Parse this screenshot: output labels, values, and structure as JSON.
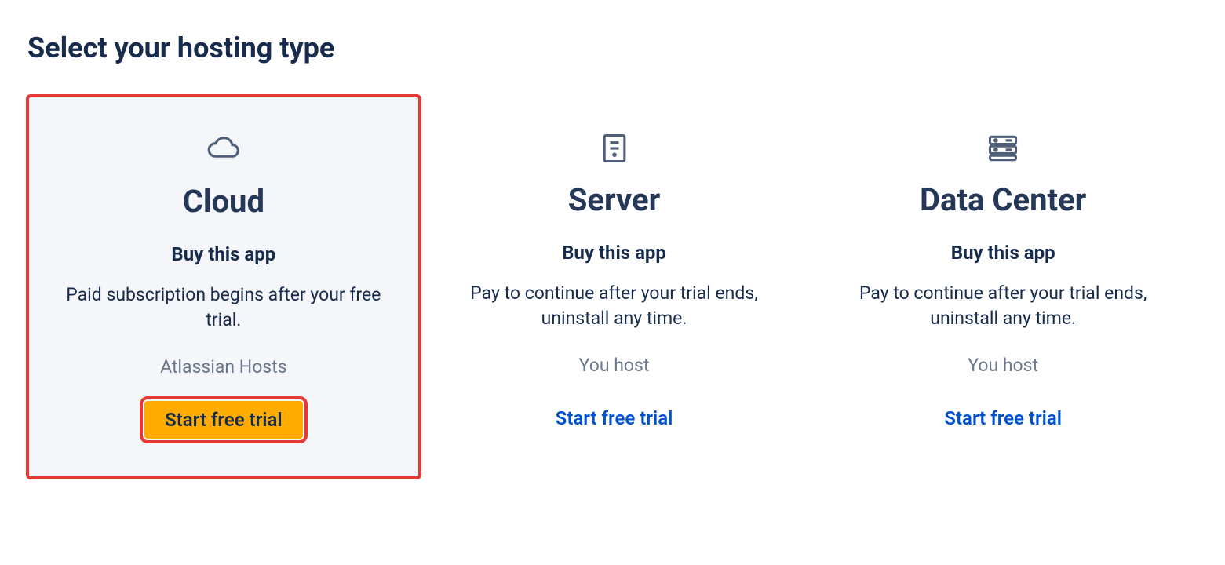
{
  "title": "Select your hosting type",
  "cards": [
    {
      "icon": "cloud",
      "title": "Cloud",
      "subtitle": "Buy this app",
      "description": "Paid subscription begins after your free trial.",
      "host": "Atlassian Hosts",
      "cta": "Start free trial",
      "selected": true,
      "ctaStyle": "button"
    },
    {
      "icon": "server",
      "title": "Server",
      "subtitle": "Buy this app",
      "description": "Pay to continue after your trial ends, uninstall any time.",
      "host": "You host",
      "cta": "Start free trial",
      "selected": false,
      "ctaStyle": "link"
    },
    {
      "icon": "datacenter",
      "title": "Data Center",
      "subtitle": "Buy this app",
      "description": "Pay to continue after your trial ends, uninstall any time.",
      "host": "You host",
      "cta": "Start free trial",
      "selected": false,
      "ctaStyle": "link"
    }
  ]
}
